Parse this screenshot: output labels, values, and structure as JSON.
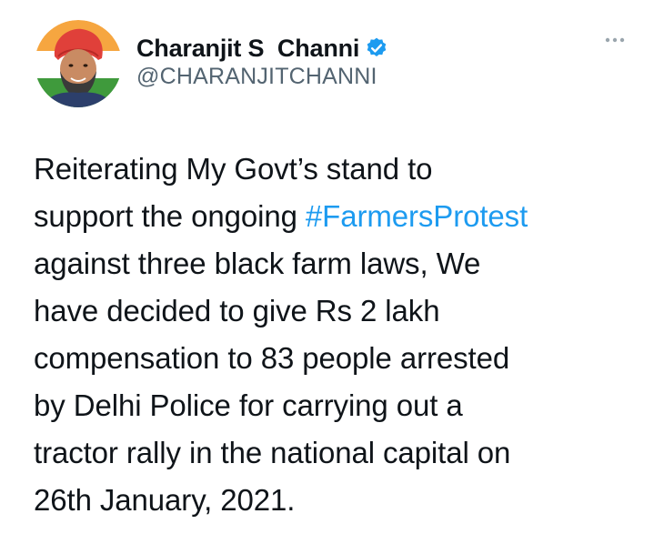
{
  "author": {
    "display_name": "Charanjit S  Channi",
    "handle": "@CHARANJITCHANNI",
    "verified": true,
    "avatar_icon": "profile-photo-avatar"
  },
  "more_menu_icon": "more-options-icon",
  "tweet": {
    "lines": [
      {
        "before": "Reiterating My Govt’s stand to",
        "hashtag": "",
        "after": ""
      },
      {
        "before": "support the ongoing ",
        "hashtag": "#FarmersProtest",
        "after": ""
      },
      {
        "before": "against three black farm laws, We",
        "hashtag": "",
        "after": ""
      },
      {
        "before": "have decided to give Rs 2 lakh",
        "hashtag": "",
        "after": ""
      },
      {
        "before": "compensation to 83 people arrested",
        "hashtag": "",
        "after": ""
      },
      {
        "before": "by Delhi Police for carrying out a",
        "hashtag": "",
        "after": ""
      },
      {
        "before": "tractor rally in the national capital on",
        "hashtag": "",
        "after": ""
      },
      {
        "before": "26th January, 2021.",
        "hashtag": "",
        "after": ""
      }
    ]
  },
  "colors": {
    "text": "#0f1419",
    "secondary": "#536471",
    "link": "#1d9bf0",
    "verified_badge": "#1d9bf0",
    "turban": "#e0403a",
    "flag_saffron": "#f39c33",
    "flag_green": "#3f9a3c"
  }
}
